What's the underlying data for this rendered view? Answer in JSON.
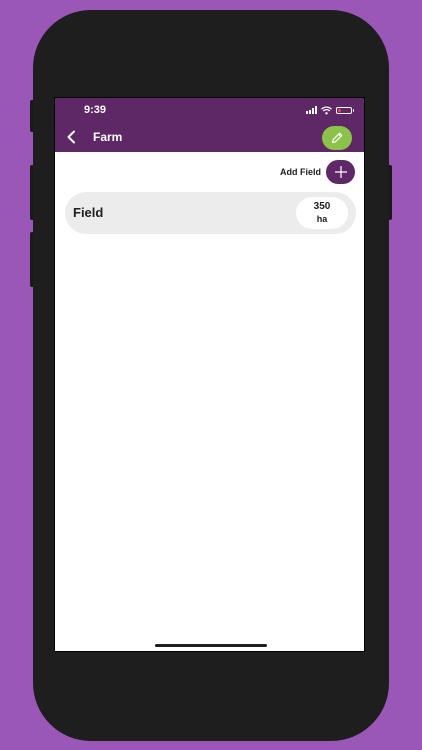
{
  "status_bar": {
    "time": "9:39"
  },
  "header": {
    "title": "Farm",
    "back_icon": "chevron-left-icon",
    "edit_icon": "pencil-icon"
  },
  "toolbar": {
    "add_field_label": "Add Field",
    "add_icon": "plus-icon"
  },
  "fields": [
    {
      "name": "Field",
      "area_value": "350",
      "area_unit": "ha"
    }
  ],
  "colors": {
    "background": "#9a57b8",
    "header": "#5e2766",
    "edit_button": "#8bc34a",
    "add_button": "#5e2766",
    "card": "#ececec"
  }
}
